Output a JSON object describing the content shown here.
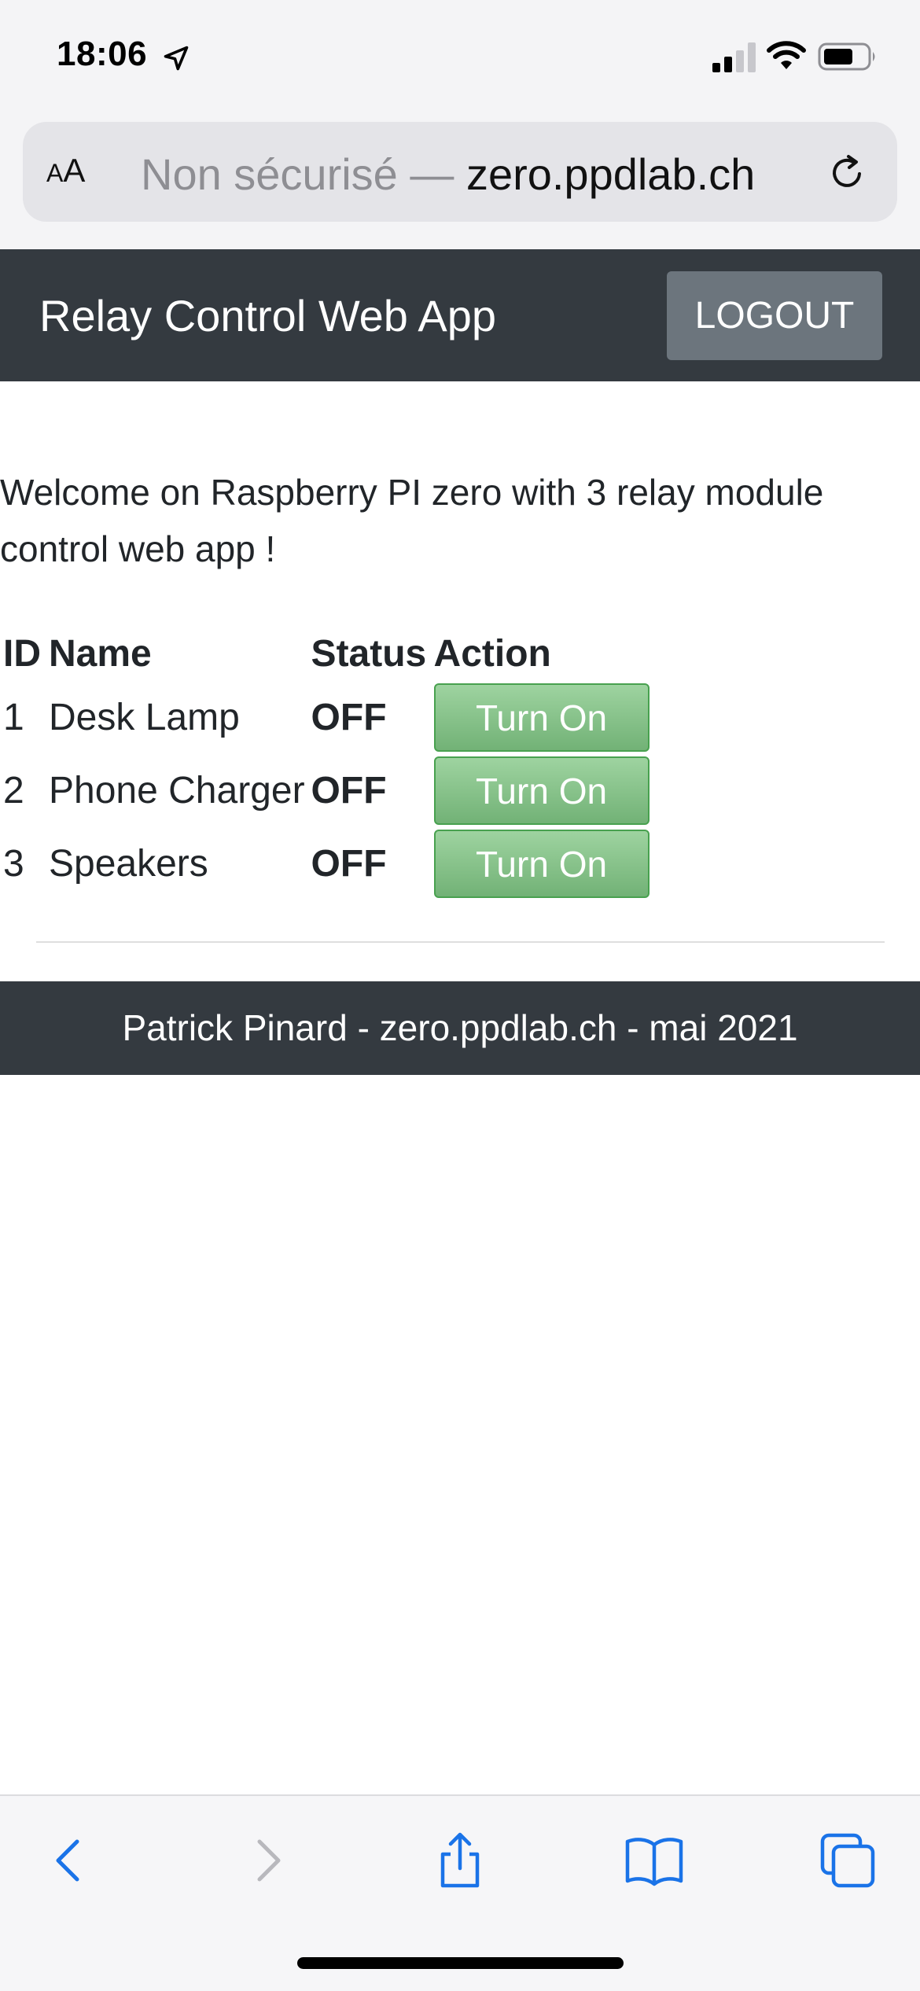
{
  "status_bar": {
    "time": "18:06"
  },
  "address_bar": {
    "aa_label_small": "A",
    "aa_label_large": "A",
    "insecure_label": "Non sécurisé — ",
    "host": "zero.ppdlab.ch"
  },
  "navbar": {
    "brand": "Relay Control Web App",
    "logout_label": "LOGOUT"
  },
  "main": {
    "welcome": "Welcome on Raspberry PI zero with 3 relay module control web app !",
    "table": {
      "headers": [
        "ID",
        "Name",
        "Status",
        "Action"
      ],
      "rows": [
        {
          "id": "1",
          "name": "Desk Lamp",
          "status": "OFF",
          "action": "Turn On"
        },
        {
          "id": "2",
          "name": "Phone Charger",
          "status": "OFF",
          "action": "Turn On"
        },
        {
          "id": "3",
          "name": "Speakers",
          "status": "OFF",
          "action": "Turn On"
        }
      ]
    }
  },
  "footer": {
    "text": "Patrick Pinard - zero.ppdlab.ch - mai 2021"
  },
  "toolbar": {
    "icons": [
      "back-icon",
      "forward-icon",
      "share-icon",
      "bookmarks-icon",
      "tabs-icon"
    ]
  },
  "colors": {
    "navbar_bg": "#343a40",
    "logout_bg": "#6c757d",
    "button_green": "#72b276",
    "safari_blue": "#1a73e8"
  }
}
